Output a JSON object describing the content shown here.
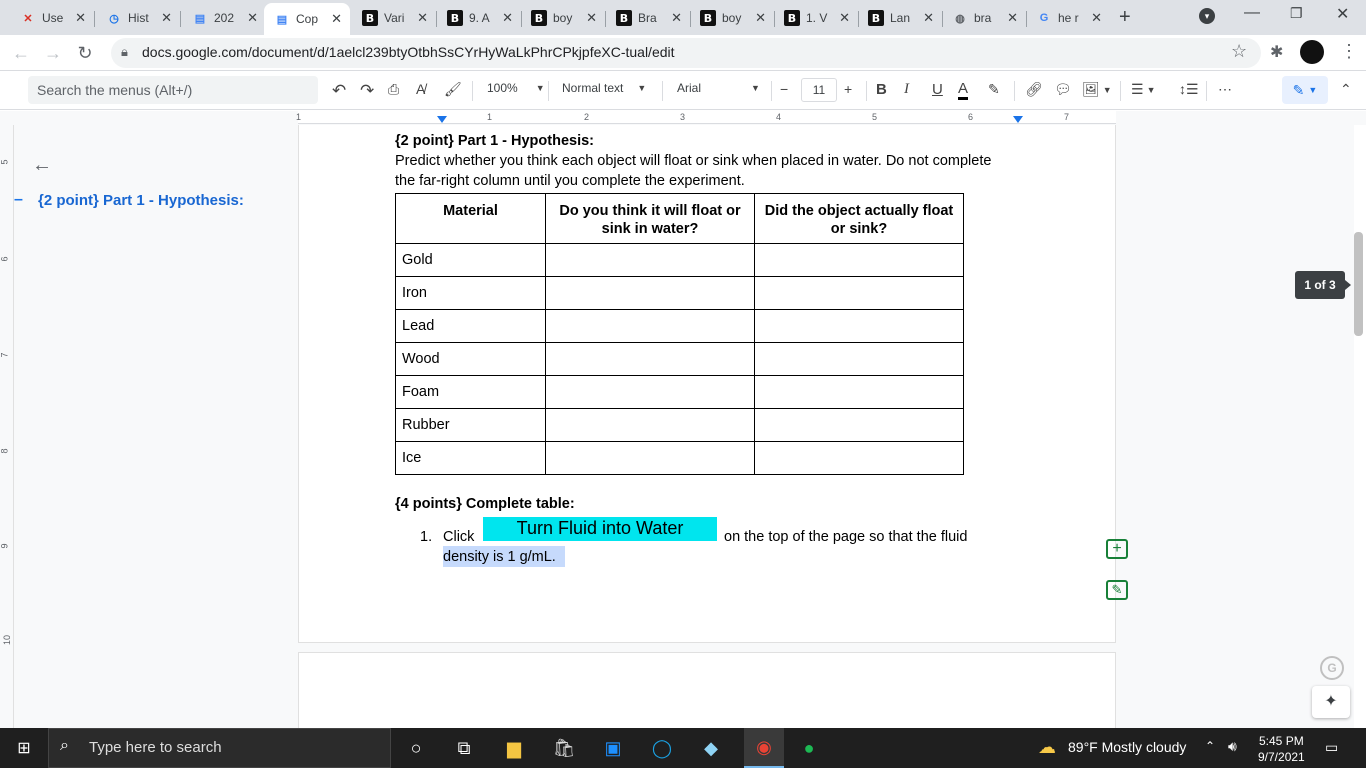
{
  "tabs": [
    {
      "title": "Use",
      "icon": "x-logo-icon"
    },
    {
      "title": "Hist",
      "icon": "history-icon"
    },
    {
      "title": "202",
      "icon": "docs-icon"
    },
    {
      "title": "Cop",
      "icon": "docs-icon",
      "active": true
    },
    {
      "title": "Vari",
      "icon": "brainly-icon"
    },
    {
      "title": "9. A",
      "icon": "brainly-icon"
    },
    {
      "title": "boy",
      "icon": "brainly-icon"
    },
    {
      "title": "Bra",
      "icon": "brainly-icon"
    },
    {
      "title": "boy",
      "icon": "brainly-icon"
    },
    {
      "title": "1. V",
      "icon": "brainly-icon"
    },
    {
      "title": "Lan",
      "icon": "brainly-icon"
    },
    {
      "title": "bra",
      "icon": "globe-icon"
    },
    {
      "title": "he r",
      "icon": "google-icon"
    }
  ],
  "address": {
    "url": "docs.google.com/document/d/1aelcl239btyOtbhSsCYrHyWaLkPhrCPkjpfeXC-tual/edit"
  },
  "toolbar": {
    "menu_search": "Search the menus (Alt+/)",
    "zoom": "100%",
    "style": "Normal text",
    "font": "Arial",
    "font_size": "11",
    "bold": "B",
    "italic": "I",
    "underline": "U",
    "text_color": "A"
  },
  "ruler": {
    "h_labels": [
      "1",
      "1",
      "2",
      "3",
      "4",
      "5",
      "6",
      "7"
    ],
    "v_labels": [
      "5",
      "6",
      "7",
      "8",
      "9",
      "10"
    ]
  },
  "outline": {
    "item": "{2 point} Part 1 - Hypothesis:"
  },
  "document": {
    "heading1": "{2 point} Part 1 - Hypothesis:",
    "para1_line1": "Predict whether you think each object will float or sink when placed in water. Do not complete",
    "para1_line2": "the far-right column until you complete the experiment.",
    "table": {
      "headers": [
        "Material",
        "Do you think it will float or sink in water?",
        "Did the object actually float or sink?"
      ],
      "rows": [
        "Gold",
        "Iron",
        "Lead",
        "Wood",
        "Foam",
        "Rubber",
        "Ice"
      ]
    },
    "heading2": "{4 points} Complete table:",
    "list_num": "1.",
    "list_click": "Click",
    "fluid_button": "Turn Fluid into Water",
    "list_rest": "on the top of the page so that the fluid",
    "list_line2": "density is 1 g/mL."
  },
  "page_indicator": "1 of 3",
  "taskbar": {
    "search": "Type here to search",
    "weather": "89°F  Mostly cloudy",
    "time": "5:45 PM",
    "date": "9/7/2021"
  }
}
